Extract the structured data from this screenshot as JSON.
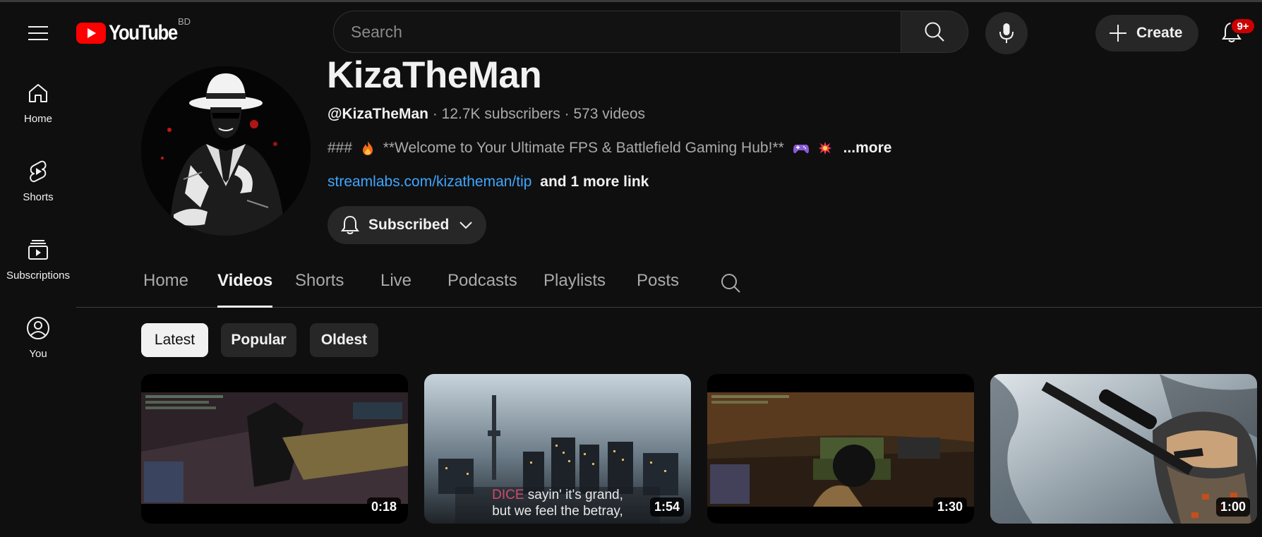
{
  "masthead": {
    "logo_text": "YouTube",
    "country_code": "BD",
    "search_placeholder": "Search",
    "create_label": "Create",
    "notification_count": "9+"
  },
  "guide": [
    {
      "label": "Home",
      "icon": "home-icon"
    },
    {
      "label": "Shorts",
      "icon": "shorts-icon"
    },
    {
      "label": "Subscriptions",
      "icon": "subscriptions-icon"
    },
    {
      "label": "You",
      "icon": "you-icon"
    }
  ],
  "channel": {
    "name": "KizaTheMan",
    "handle": "@KizaTheMan",
    "subscribers": "12.7K subscribers",
    "videos": "573 videos",
    "separator": " · ",
    "description_prefix": "### ",
    "description_text": " **Welcome to Your Ultimate FPS & Battlefield Gaming Hub!** ",
    "description_more": "...more",
    "link": "streamlabs.com/kizatheman/tip",
    "more_links": "and 1 more link",
    "subscribe_label": "Subscribed"
  },
  "tabs": [
    {
      "label": "Home",
      "active": false
    },
    {
      "label": "Videos",
      "active": true
    },
    {
      "label": "Shorts",
      "active": false
    },
    {
      "label": "Live",
      "active": false
    },
    {
      "label": "Podcasts",
      "active": false
    },
    {
      "label": "Playlists",
      "active": false
    },
    {
      "label": "Posts",
      "active": false
    }
  ],
  "chips": [
    {
      "label": "Latest",
      "selected": true
    },
    {
      "label": "Popular",
      "selected": false
    },
    {
      "label": "Oldest",
      "selected": false
    }
  ],
  "videos": [
    {
      "duration": "0:18"
    },
    {
      "duration": "1:54",
      "caption_line1_red": "DICE",
      "caption_line1_rest": " sayin' it's grand,",
      "caption_line2": "but we feel the betray,"
    },
    {
      "duration": "1:30"
    },
    {
      "duration": "1:00"
    }
  ],
  "colors": {
    "background": "#0f0f0f",
    "brand_red": "#ff0000",
    "link_blue": "#3ea6ff",
    "chip_bg": "#272727",
    "badge_red": "#cc0000"
  }
}
